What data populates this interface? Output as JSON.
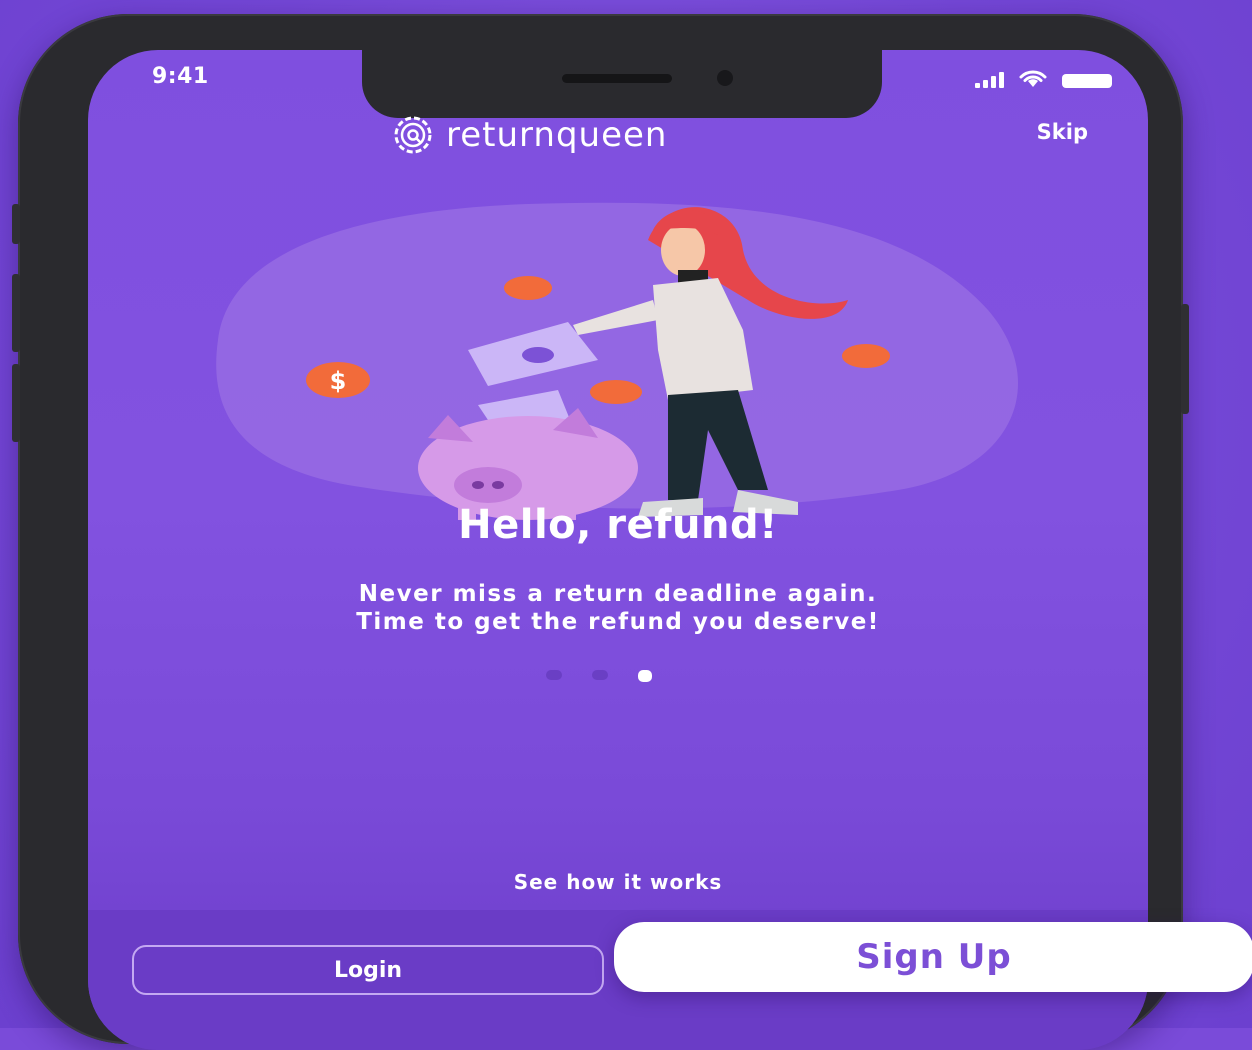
{
  "status_bar": {
    "time": "9:41",
    "icons": [
      "signal-icon",
      "wifi-icon",
      "battery-icon"
    ]
  },
  "header": {
    "brand_name": "returnqueen",
    "logo_icon": "gear-q-logo-icon",
    "skip_label": "Skip"
  },
  "onboarding": {
    "illustration": "woman-refund-piggy-bank-illustration",
    "title": "Hello, refund!",
    "subtitle_line1": "Never miss a return deadline again.",
    "subtitle_line2": "Time to get the refund you deserve!",
    "page_count": 3,
    "active_page": 3
  },
  "footer": {
    "how_it_works_label": "See how it works",
    "login_label": "Login",
    "signup_label": "Sign Up"
  },
  "colors": {
    "background": "#7a4bd9",
    "accent": "#7c4fd6",
    "coin": "#f26b3a",
    "piggy": "#d69ae8"
  }
}
